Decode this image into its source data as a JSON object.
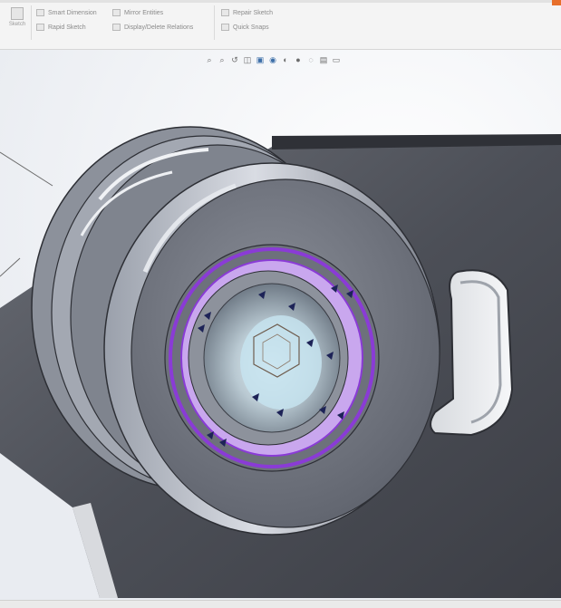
{
  "ribbon": {
    "commands": [
      {
        "icon": "sketch-icon",
        "label": "Sketch"
      },
      {
        "icon": "smart-dimension-icon",
        "label": "Smart Dimension"
      },
      {
        "icon": "rapid-sketch-icon",
        "label": "Rapid Sketch"
      },
      {
        "icon": "mirror-entities-icon",
        "label": "Mirror Entities"
      },
      {
        "icon": "display-delete-relations-icon",
        "label": "Display/Delete Relations"
      },
      {
        "icon": "repair-sketch-icon",
        "label": "Repair Sketch"
      },
      {
        "icon": "quick-snaps-icon",
        "label": "Quick Snaps"
      }
    ],
    "accent_color": "#e76f2b"
  },
  "heads_up_toolbar": {
    "tools": [
      {
        "name": "zoom-to-fit",
        "icon": "zoom-fit-icon",
        "glyph": "⌕"
      },
      {
        "name": "zoom-to-area",
        "icon": "zoom-area-icon",
        "glyph": "⌕"
      },
      {
        "name": "previous-view",
        "icon": "previous-view-icon",
        "glyph": "↺"
      },
      {
        "name": "section-view",
        "icon": "section-view-icon",
        "glyph": "◫"
      },
      {
        "name": "view-orientation",
        "icon": "view-orientation-icon",
        "glyph": "▣"
      },
      {
        "name": "display-style",
        "icon": "display-style-icon",
        "glyph": "◉"
      },
      {
        "name": "hide-show-items",
        "icon": "hide-show-icon",
        "glyph": "◐"
      },
      {
        "name": "edit-appearance",
        "icon": "appearance-icon",
        "glyph": "●"
      },
      {
        "name": "apply-scene",
        "icon": "scene-icon",
        "glyph": "◌"
      },
      {
        "name": "view-settings",
        "icon": "view-settings-icon",
        "glyph": "▤"
      },
      {
        "name": "display-pane",
        "icon": "display-pane-icon",
        "glyph": "▭"
      }
    ]
  },
  "model": {
    "description_colors": {
      "part": "#5a5d66",
      "bolt": "#c9d6de",
      "selection": "#8a3bd6",
      "markers": "#1d2357"
    }
  }
}
